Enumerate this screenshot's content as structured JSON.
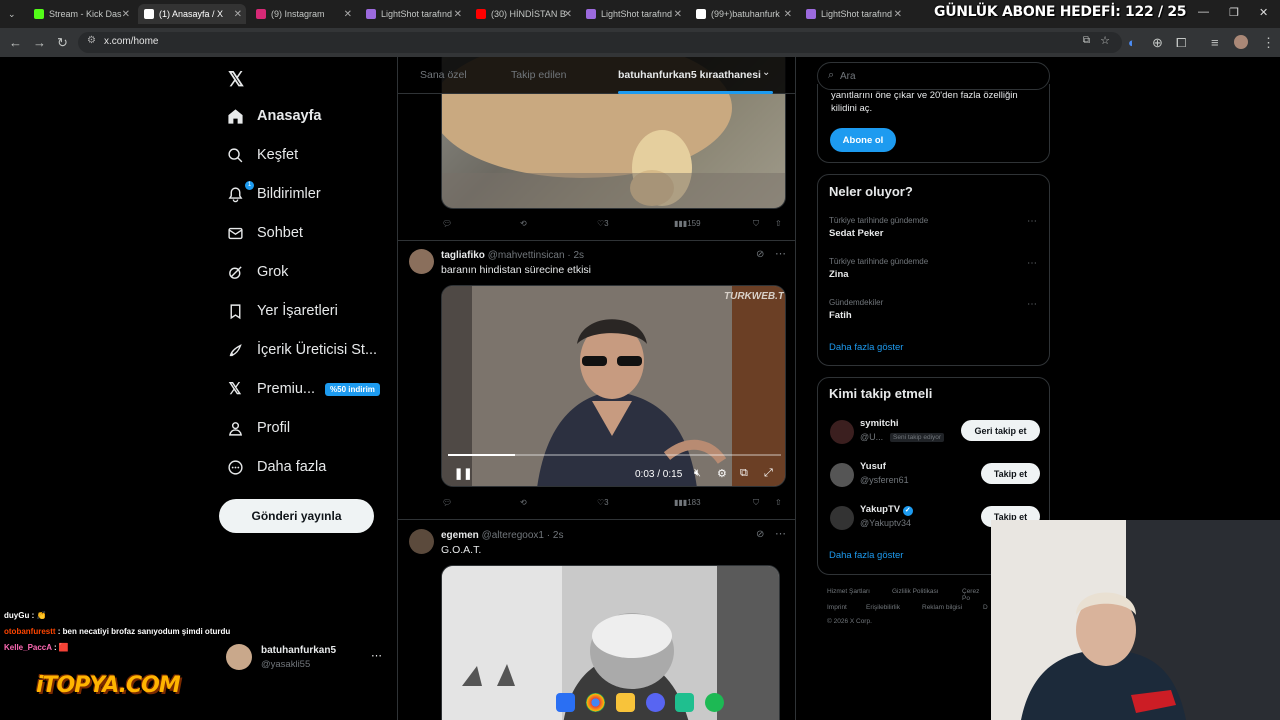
{
  "browser": {
    "tabs": [
      {
        "label": "Stream - Kick Das",
        "color": "#53fc18",
        "active": false
      },
      {
        "label": "(1) Anasayfa / X",
        "color": "#ffffff",
        "active": true
      },
      {
        "label": "(9) Instagram",
        "color": "#d62976",
        "active": false
      },
      {
        "label": "LightShot tarafınd",
        "color": "#9c6ade",
        "active": false
      },
      {
        "label": "(30) HİNDİSTAN B",
        "color": "#ff0000",
        "active": false
      },
      {
        "label": "LightShot tarafınd",
        "color": "#9c6ade",
        "active": false
      },
      {
        "label": "(99+)batuhanfurk",
        "color": "#ffffff",
        "active": false
      },
      {
        "label": "LightShot tarafınd",
        "color": "#9c6ade",
        "active": false
      }
    ],
    "url": "x.com/home"
  },
  "overlay_title": "GÜNLÜK ABONE HEDEFİ: 122 / 25",
  "nav": {
    "items": [
      {
        "label": "Anasayfa",
        "icon": "home-icon",
        "bold": true
      },
      {
        "label": "Keşfet",
        "icon": "search-icon"
      },
      {
        "label": "Bildirimler",
        "icon": "bell-icon",
        "badge": "1"
      },
      {
        "label": "Sohbet",
        "icon": "mail-icon"
      },
      {
        "label": "Grok",
        "icon": "grok-icon"
      },
      {
        "label": "Yer İşaretleri",
        "icon": "bookmark-icon"
      },
      {
        "label": "İçerik Üreticisi St...",
        "icon": "rocket-icon"
      },
      {
        "label": "Premiu...",
        "icon": "x-icon",
        "pill": "%50 indirim"
      },
      {
        "label": "Profil",
        "icon": "person-icon"
      },
      {
        "label": "Daha fazla",
        "icon": "more-circle-icon"
      }
    ],
    "post_button": "Gönderi yayınla",
    "account": {
      "name": "batuhanfurkan5",
      "handle": "@yasakli55"
    }
  },
  "feed": {
    "tabs": [
      "Sana özel",
      "Takip edilen",
      "batuhanfurkan5 kıraathanesi"
    ],
    "first_tweet_actions": {
      "likes": "3",
      "views": "159"
    },
    "tweets": [
      {
        "name": "tagliafiko",
        "handle": "@mahvettinsican",
        "time": "2s",
        "text": "baranın hindistan sürecine etkisi",
        "watermark": "TURKWEB.TV",
        "video_time": "0:03 / 0:15",
        "video_progress": 0.2,
        "likes": "3",
        "views": "183"
      },
      {
        "name": "egemen",
        "handle": "@alteregoox1",
        "time": "2s",
        "text": "G.O.A.T."
      }
    ]
  },
  "right": {
    "search_placeholder": "Ara",
    "premium_text_1": "yanıtlarını öne çıkar ve 20'den fazla özelliğin",
    "premium_text_2": "kilidini aç.",
    "subscribe": "Abone ol",
    "trends_title": "Neler oluyor?",
    "trends": [
      {
        "meta": "Türkiye tarihinde gündemde",
        "name": "Sedat Peker"
      },
      {
        "meta": "Türkiye tarihinde gündemde",
        "name": "Zina"
      },
      {
        "meta": "Gündemdekiler",
        "name": "Fatih"
      }
    ],
    "show_more": "Daha fazla göster",
    "wtf_title": "Kimi takip etmeli",
    "who_to_follow": [
      {
        "name": "symitchi",
        "handle": "@U...",
        "tag": "Seni takip ediyor",
        "button": "Geri takip et"
      },
      {
        "name": "Yusuf",
        "handle": "@ysferen61",
        "button": "Takip et"
      },
      {
        "name": "YakupTV",
        "handle": "@Yakuptv34",
        "button": "Takip et",
        "verified": true
      }
    ],
    "wtf_show_more": "Daha fazla göster",
    "footer": [
      "Hizmet Şartları",
      "Gizlilik Politikası",
      "Çerez Po",
      "Imprint",
      "Erişilebilirlik",
      "Reklam bilgisi",
      "D",
      "© 2026 X Corp."
    ]
  },
  "chat": [
    {
      "user": "duyGu",
      "color": "#ffffff",
      "msg": "👏"
    },
    {
      "user": "otobanfurestt",
      "color": "#ff4500",
      "msg": "ben necatiyi brofaz sanıyodum şimdi oturdu"
    },
    {
      "user": "Kelle_PaccA",
      "color": "#ff69b4",
      "msg": "🟥"
    }
  ],
  "sponsor_logo": "iTOPYA.COM",
  "colors": {
    "accent": "#1d9bf0",
    "bg": "#000000",
    "border": "#2f3336",
    "muted": "#71767b"
  }
}
